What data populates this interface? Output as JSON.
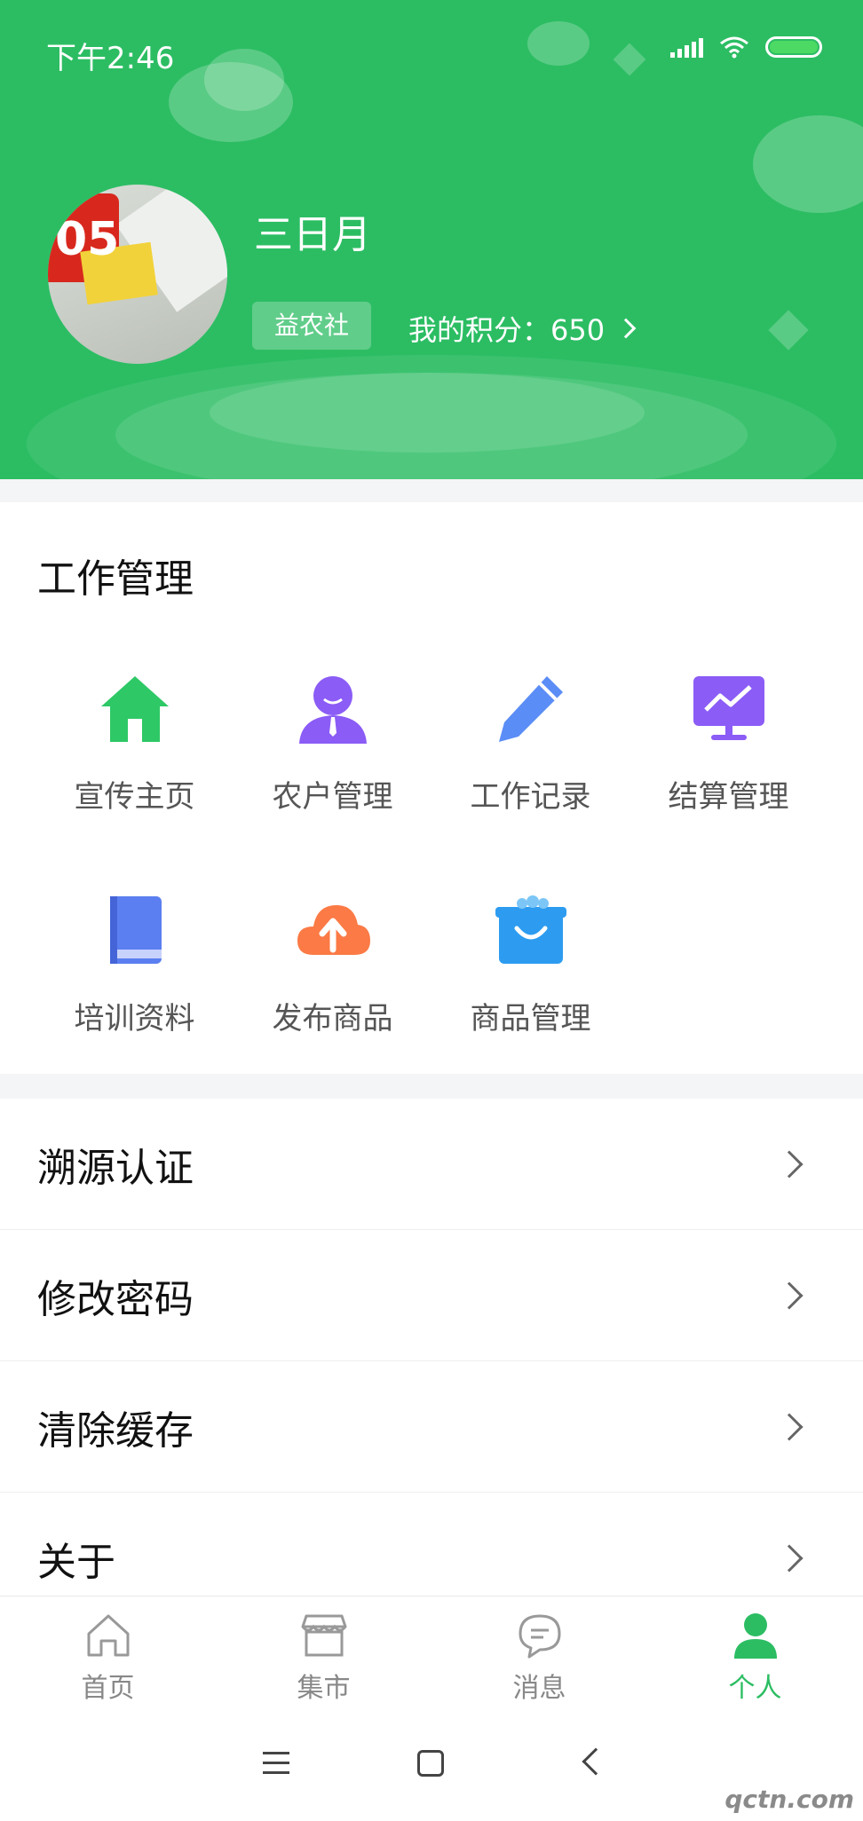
{
  "status_bar": {
    "time": "下午2:46"
  },
  "profile": {
    "name": "三日月",
    "org_badge": "益农社",
    "points_label": "我的积分：650"
  },
  "work": {
    "title": "工作管理",
    "items": [
      {
        "label": "宣传主页",
        "icon": "home-icon",
        "color": "#2ec866"
      },
      {
        "label": "农户管理",
        "icon": "farmer-user-icon",
        "color": "#8b5cf6"
      },
      {
        "label": "工作记录",
        "icon": "pencil-icon",
        "color": "#5b8df6"
      },
      {
        "label": "结算管理",
        "icon": "monitor-chart-icon",
        "color": "#8b5cf6"
      },
      {
        "label": "培训资料",
        "icon": "book-icon",
        "color": "#5b7ff0"
      },
      {
        "label": "发布商品",
        "icon": "cloud-upload-icon",
        "color": "#fb7a45"
      },
      {
        "label": "商品管理",
        "icon": "shopping-bag-icon",
        "color": "#2d9cf0"
      }
    ]
  },
  "menu": {
    "items": [
      {
        "label": "溯源认证"
      },
      {
        "label": "修改密码"
      },
      {
        "label": "清除缓存"
      },
      {
        "label": "关于"
      }
    ]
  },
  "tabbar": {
    "tabs": [
      {
        "label": "首页",
        "icon": "home-outline-icon"
      },
      {
        "label": "集市",
        "icon": "store-icon"
      },
      {
        "label": "消息",
        "icon": "chat-icon"
      },
      {
        "label": "个人",
        "icon": "person-icon",
        "active": true
      }
    ]
  },
  "watermark": "qctn.com",
  "colors": {
    "brand": "#2cbd63",
    "active_tab": "#2cbd63"
  }
}
